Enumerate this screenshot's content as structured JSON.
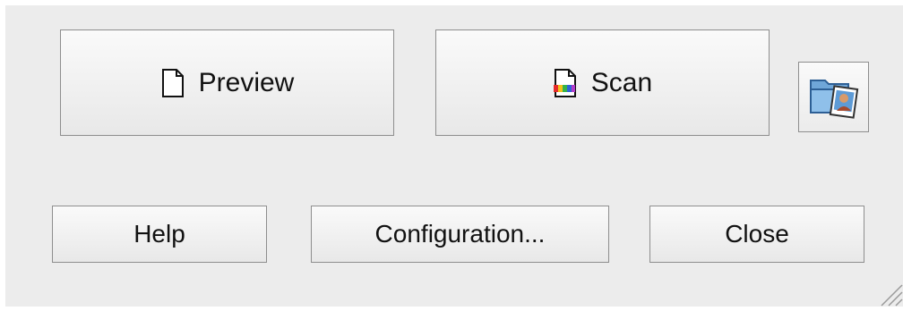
{
  "buttons": {
    "preview_label": "Preview",
    "scan_label": "Scan",
    "help_label": "Help",
    "configuration_label": "Configuration...",
    "close_label": "Close"
  },
  "icons": {
    "preview": "document-icon",
    "scan": "color-document-icon",
    "browse": "folder-photo-icon",
    "resize": "resize-grip-icon"
  },
  "colors": {
    "window_background": "#ececec",
    "button_border": "#8e8e8e",
    "folder_blue": "#6fa6d8"
  }
}
